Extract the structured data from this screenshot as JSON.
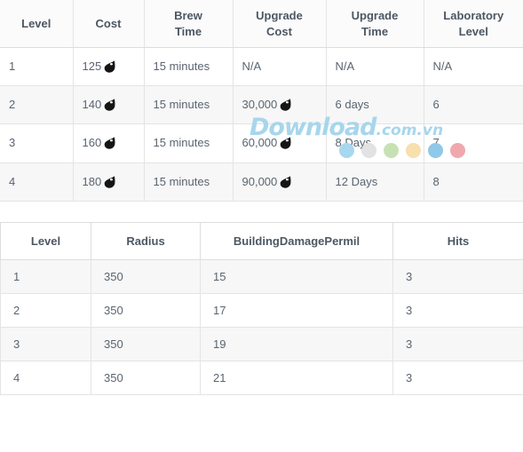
{
  "table_brew": {
    "name": "brew-stats-table",
    "columns": [
      "Level",
      "Cost",
      "Brew Time",
      "Upgrade Cost",
      "Upgrade Time",
      "Laboratory Level"
    ],
    "column_lines": [
      [
        "Level"
      ],
      [
        "Cost"
      ],
      [
        "Brew",
        "Time"
      ],
      [
        "Upgrade",
        "Cost"
      ],
      [
        "Upgrade",
        "Time"
      ],
      [
        "Laboratory",
        "Level"
      ]
    ],
    "rows": [
      {
        "level": "1",
        "cost": "125",
        "cost_icon": "dark-elixir-drop-icon",
        "brew_time": "15 minutes",
        "upgrade_cost": "N/A",
        "upgrade_cost_icon": false,
        "upgrade_time": "N/A",
        "laboratory_level": "N/A"
      },
      {
        "level": "2",
        "cost": "140",
        "cost_icon": "dark-elixir-drop-icon",
        "brew_time": "15 minutes",
        "upgrade_cost": "30,000",
        "upgrade_cost_icon": true,
        "upgrade_time": "6 days",
        "laboratory_level": "6"
      },
      {
        "level": "3",
        "cost": "160",
        "cost_icon": "dark-elixir-drop-icon",
        "brew_time": "15 minutes",
        "upgrade_cost": "60,000",
        "upgrade_cost_icon": true,
        "upgrade_time": "8 Days",
        "laboratory_level": "7"
      },
      {
        "level": "4",
        "cost": "180",
        "cost_icon": "dark-elixir-drop-icon",
        "brew_time": "15 minutes",
        "upgrade_cost": "90,000",
        "upgrade_cost_icon": true,
        "upgrade_time": "12 Days",
        "laboratory_level": "8"
      }
    ]
  },
  "table_damage": {
    "name": "damage-stats-table",
    "columns": [
      "Level",
      "Radius",
      "BuildingDamagePermil",
      "Hits"
    ],
    "rows": [
      {
        "level": "1",
        "radius": "350",
        "building_damage_permil": "15",
        "hits": "3"
      },
      {
        "level": "2",
        "radius": "350",
        "building_damage_permil": "17",
        "hits": "3"
      },
      {
        "level": "3",
        "radius": "350",
        "building_damage_permil": "19",
        "hits": "3"
      },
      {
        "level": "4",
        "radius": "350",
        "building_damage_permil": "21",
        "hits": "3"
      }
    ]
  },
  "watermark": {
    "brand": "Download",
    "suffix": ".com.vn",
    "color": "#a7d6ec",
    "dots": [
      "#a8d8ee",
      "#e2e2e2",
      "#c6e2b4",
      "#f7dfae",
      "#8fc8e8",
      "#f0a8ae"
    ]
  },
  "colors": {
    "header_text": "#4c5763",
    "cell_text": "#5a6470",
    "border": "#e4e4e4",
    "stripe": "#f7f7f7",
    "elixir_icon": "#151515"
  }
}
